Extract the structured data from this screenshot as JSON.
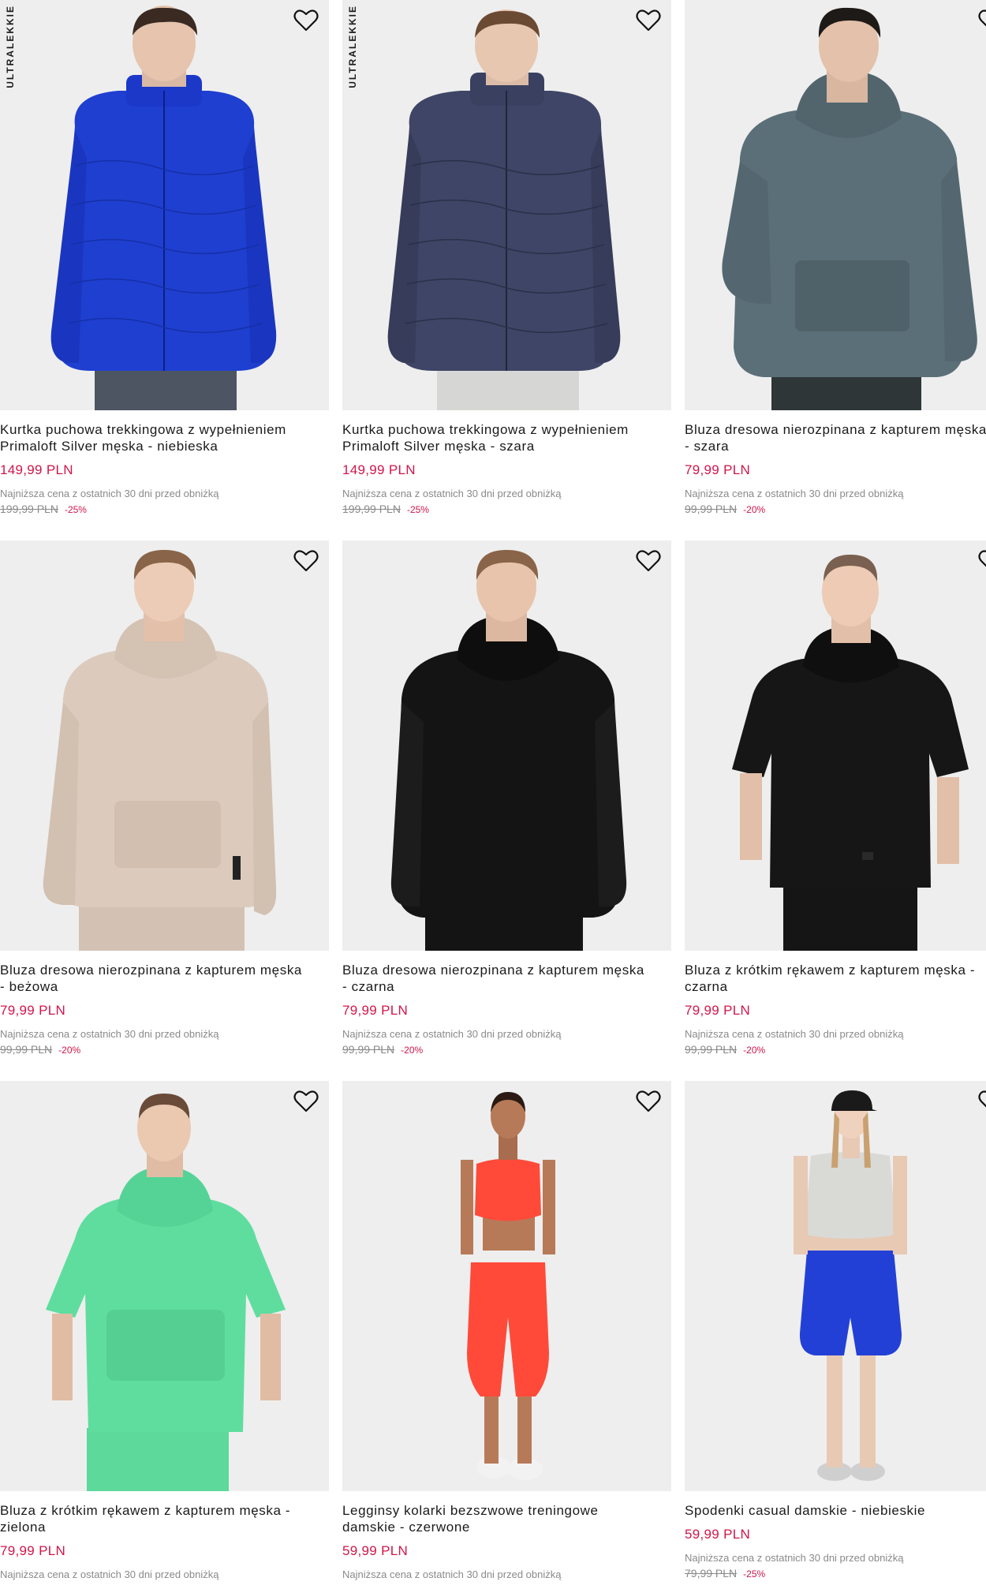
{
  "common": {
    "lowest_label": "Najniższa cena z ostatnich 30 dni przed obniżką",
    "badge": "ULTRALEKKIE"
  },
  "products": [
    {
      "line1": "Kurtka puchowa trekkingowa z wypełnieniem",
      "line2": "Primaloft Silver męska - niebieska",
      "price": "149,99 PLN",
      "old_price": "199,99 PLN",
      "discount": "-25%",
      "badge": true,
      "favorite_icon": "heart-outline"
    },
    {
      "line1": "Kurtka puchowa trekkingowa z wypełnieniem",
      "line2": "Primaloft Silver męska - szara",
      "price": "149,99 PLN",
      "old_price": "199,99 PLN",
      "discount": "-25%",
      "badge": true,
      "favorite_icon": "heart-outline"
    },
    {
      "line1": "Bluza dresowa nierozpinana z kapturem męska",
      "line2": "- szara",
      "price": "79,99 PLN",
      "old_price": "99,99 PLN",
      "discount": "-20%",
      "badge": false,
      "favorite_icon": "heart-outline"
    },
    {
      "line1": "Bluza dresowa nierozpinana z kapturem męska",
      "line2": "- beżowa",
      "price": "79,99 PLN",
      "old_price": "99,99 PLN",
      "discount": "-20%",
      "badge": false,
      "favorite_icon": "heart-outline"
    },
    {
      "line1": "Bluza dresowa nierozpinana z kapturem męska",
      "line2": "- czarna",
      "price": "79,99 PLN",
      "old_price": "99,99 PLN",
      "discount": "-20%",
      "badge": false,
      "favorite_icon": "heart-outline"
    },
    {
      "line1": "Bluza z krótkim rękawem z kapturem męska -",
      "line2": "czarna",
      "price": "79,99 PLN",
      "old_price": "99,99 PLN",
      "discount": "-20%",
      "badge": false,
      "favorite_icon": "heart-outline"
    },
    {
      "line1": "Bluza z krótkim rękawem z kapturem męska -",
      "line2": "zielona",
      "price": "79,99 PLN",
      "old_price": "",
      "discount": "",
      "badge": false,
      "favorite_icon": "heart-outline"
    },
    {
      "line1": "Legginsy kolarki bezszwowe treningowe",
      "line2": "damskie - czerwone",
      "price": "59,99 PLN",
      "old_price": "",
      "discount": "",
      "badge": false,
      "favorite_icon": "heart-outline"
    },
    {
      "line1": "Spodenki casual damskie - niebieskie",
      "line2": "",
      "price": "59,99 PLN",
      "old_price": "79,99 PLN",
      "discount": "-25%",
      "badge": false,
      "favorite_icon": "heart-outline"
    }
  ],
  "colors": {
    "price": "#d0164a",
    "muted": "#8a8a8a",
    "photo_bg": "#eeeeee",
    "jacket_blue": "#1f3fd0",
    "jacket_navy": "#3e4566",
    "hoodie_grey": "#5b6f78",
    "hoodie_beige": "#dccbbd",
    "hoodie_black": "#141414",
    "tee_black": "#161616",
    "tee_green": "#5fdd9f",
    "leggings_red": "#ff4a3a",
    "shorts_blue": "#2340d6"
  }
}
